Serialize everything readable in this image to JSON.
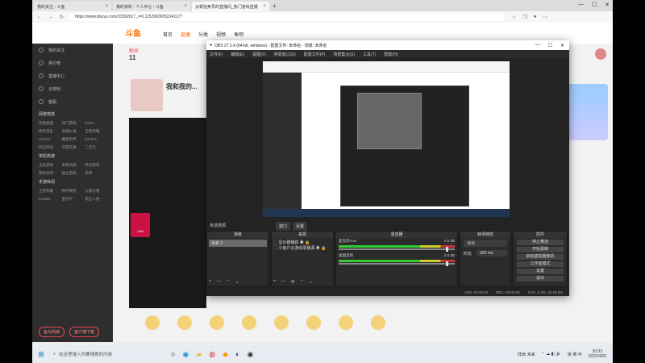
{
  "browser": {
    "tabs": [
      {
        "label": "我的关注 - 斗鱼",
        "active": false
      },
      {
        "label": "我的资料 - 个人中心 - 斗鱼",
        "active": false
      },
      {
        "label": "云顿拍卖员的直播间_热门游戏直播",
        "active": true
      }
    ],
    "url": "https://www.douyu.com/31592617_r=0.11529936552241177",
    "window_controls": [
      "—",
      "☐",
      "✕"
    ]
  },
  "site": {
    "logo": "斗鱼",
    "nav": [
      "首页",
      "直播",
      "分类",
      "视频",
      "鱼吧"
    ],
    "sidebar": {
      "items": [
        "我的关注",
        "排行榜",
        "直播中心",
        "云游戏",
        "客服"
      ],
      "sections": [
        {
          "title": "网游竞技",
          "games": [
            "英雄联盟",
            "热门游戏",
            "DOTA",
            "绝地求生",
            "穿越火线",
            "王者荣耀",
            "CS:GO",
            "魔兽世界",
            "DOTA2",
            "炉石传说",
            "守望先锋",
            "二次元"
          ]
        },
        {
          "title": "单机热游",
          "games": [
            "主机游戏",
            "单机热游",
            "怀旧游戏",
            "我的世界",
            "独立游戏",
            "原神"
          ]
        },
        {
          "title": "手游休闲",
          "games": [
            "王者荣耀",
            "和平精英",
            "火影忍者",
            "CODM",
            "金铲铲",
            "第五人格"
          ]
        }
      ],
      "bottom_pills": [
        "鱼丸商城",
        "客户端下载"
      ]
    },
    "counter_label": "粉丝",
    "counter_value": "11",
    "streamer_name": "我和我的...",
    "gift_box_label": "1/50"
  },
  "obs": {
    "title": "OBS 27.2.4 (64-bit, windows) - 配置文件: 未命名 - 场景: 未命名",
    "menu": [
      "文件(F)",
      "编辑(E)",
      "视图(V)",
      "停靠窗口(D)",
      "配置文件(P)",
      "场景集合(S)",
      "工具(T)",
      "帮助(H)"
    ],
    "preview_tabs": [
      "窗口",
      "设置"
    ],
    "scenes_label": "未选择源",
    "docks": {
      "scenes": {
        "header": "场景",
        "items": [
          "场景 2"
        ]
      },
      "sources": {
        "header": "来源",
        "items": [
          "显示器捕获",
          "小窗户云游戏录播源"
        ]
      },
      "mixer": {
        "header": "混音器",
        "tracks": [
          {
            "name": "桌面音频",
            "level": "0.0 dB"
          },
          {
            "name": "麦克风/Aux",
            "level": "0.0 dB"
          }
        ]
      },
      "transitions": {
        "header": "转场特效",
        "type": "淡出",
        "duration_label": "时长",
        "duration": "300 ms"
      },
      "controls": {
        "header": "控件",
        "buttons": [
          "停止推流",
          "开始录制",
          "启动虚拟摄像机",
          "工作室模式",
          "设置",
          "退出"
        ]
      }
    },
    "status": [
      "LIVE: 00:00:00",
      "REC: 00:00:00",
      "CPU: 2.3%, 30.00 fps"
    ]
  },
  "taskbar": {
    "search_placeholder": "在这里输入你要搜索的内容",
    "ime": "拼 英 中",
    "time": "20:33",
    "date": "2022/4/25",
    "tray_text": "阵雨 未来"
  }
}
